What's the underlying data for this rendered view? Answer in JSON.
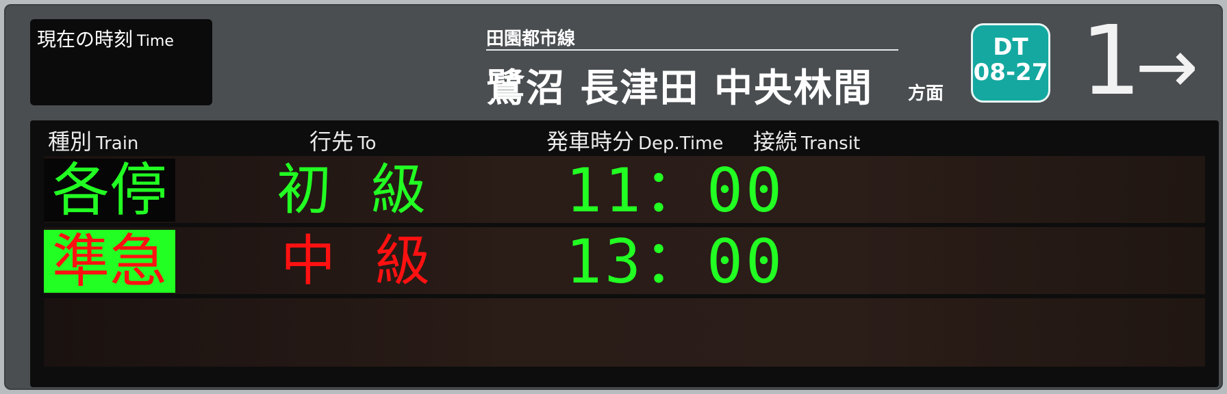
{
  "clock": {
    "label_ja": "現在の時刻",
    "label_en": "Time"
  },
  "line": {
    "name": "田園都市線"
  },
  "direction": {
    "destinations": "鷺沼 長津田 中央林間",
    "suffix": "方面"
  },
  "station_badge": {
    "line_code": "DT",
    "number": "08-27",
    "color": "#14a8a0"
  },
  "platform": {
    "number": "1",
    "arrow": "→"
  },
  "headers": {
    "train_ja": "種別",
    "train_en": "Train",
    "to_ja": "行先",
    "to_en": "To",
    "dep_ja": "発車時分",
    "dep_en": "Dep.Time",
    "transit_ja": "接続",
    "transit_en": "Transit"
  },
  "departures": [
    {
      "type": "各停",
      "type_style": "green-on-black",
      "to": "初級",
      "to_color": "#22ff22",
      "time": "11：00"
    },
    {
      "type": "準急",
      "type_style": "red-on-green",
      "to": "中級",
      "to_color": "#ff1111",
      "time": "13：00"
    }
  ]
}
